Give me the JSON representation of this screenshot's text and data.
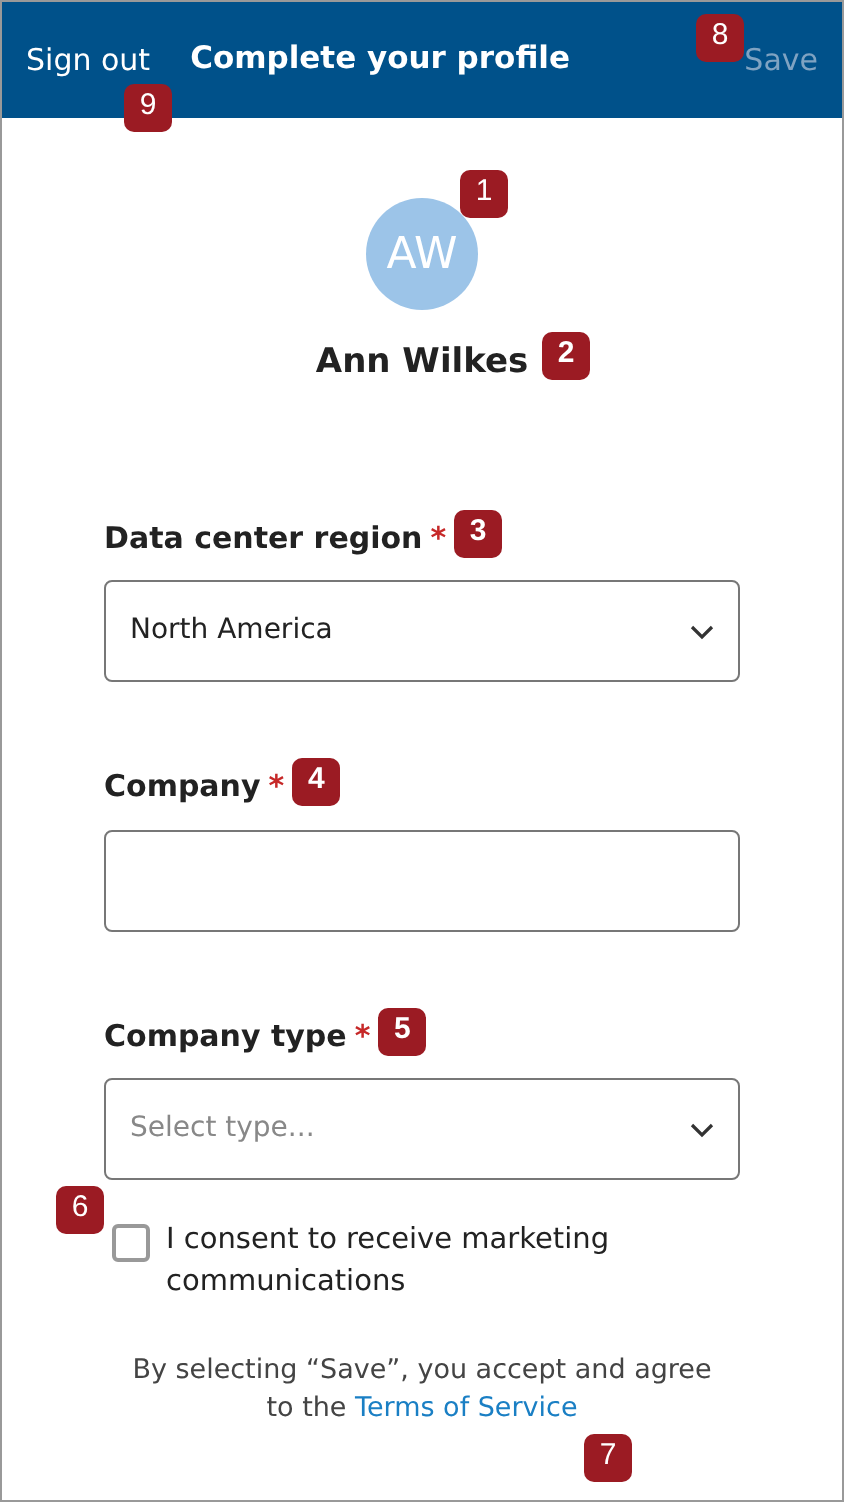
{
  "header": {
    "sign_out": {
      "label": "Sign out",
      "callout": "9"
    },
    "title": "Complete your profile",
    "save": {
      "label": "Save",
      "disabled": true,
      "callout": "8"
    }
  },
  "avatar": {
    "initials": "AW",
    "callout": "1"
  },
  "user_name": {
    "text": "Ann Wilkes",
    "callout": "2"
  },
  "fields": [
    {
      "kind": "select",
      "label": "Data center region",
      "required_mark": "*",
      "value": "North America",
      "callout": "3"
    },
    {
      "kind": "text",
      "label": "Company",
      "required_mark": "*",
      "callout": "4"
    },
    {
      "kind": "select",
      "label": "Company type",
      "required_mark": "*",
      "placeholder": "Select type...",
      "callout": "5"
    }
  ],
  "consent": {
    "label": "I consent to receive marketing communications",
    "checked": false,
    "callout": "6"
  },
  "terms": {
    "text": "By selecting “Save”, you accept and agree to the",
    "link": "Terms of Service",
    "callout": "7"
  }
}
